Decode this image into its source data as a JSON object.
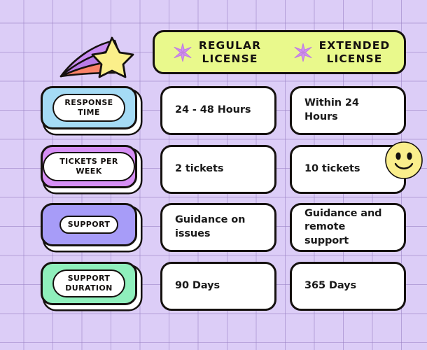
{
  "page": {
    "background_color": "#DCCDF7",
    "grid_line_color": "#967EC2",
    "outline_color": "#15110F"
  },
  "decorations": {
    "shooting_star": {
      "icon": "shooting-star-icon",
      "star_color": "#FBEF8A",
      "trail_colors": [
        "#C98CF2",
        "#B97CE8",
        "#FA8268"
      ]
    },
    "smiley": {
      "icon": "smiley-face-icon",
      "color": "#FAEE8C"
    }
  },
  "header": {
    "background_color": "#E9F98C",
    "columns": [
      {
        "icon": "sparkle-asterisk-icon",
        "icon_color": "#D290F0",
        "title": "REGULAR\nLICENSE"
      },
      {
        "icon": "sparkle-asterisk-icon",
        "icon_color": "#D290F0",
        "title": "EXTENDED\nLICENSE"
      }
    ]
  },
  "rows": [
    {
      "label": "RESPONSE\nTIME",
      "chip_color": "#A5DBF5",
      "regular": "24 - 48 Hours",
      "extended": "Within 24 Hours"
    },
    {
      "label": "TICKETS PER WEEK",
      "chip_color": "#D68FF5",
      "regular": "2 tickets",
      "extended": "10 tickets"
    },
    {
      "label": "SUPPORT",
      "chip_color": "#A79CF8",
      "regular": "Guidance on\nissues",
      "extended": "Guidance and\nremote support"
    },
    {
      "label": "SUPPORT\nDURATION",
      "chip_color": "#8FEFBC",
      "regular": "90 Days",
      "extended": "365 Days"
    }
  ]
}
